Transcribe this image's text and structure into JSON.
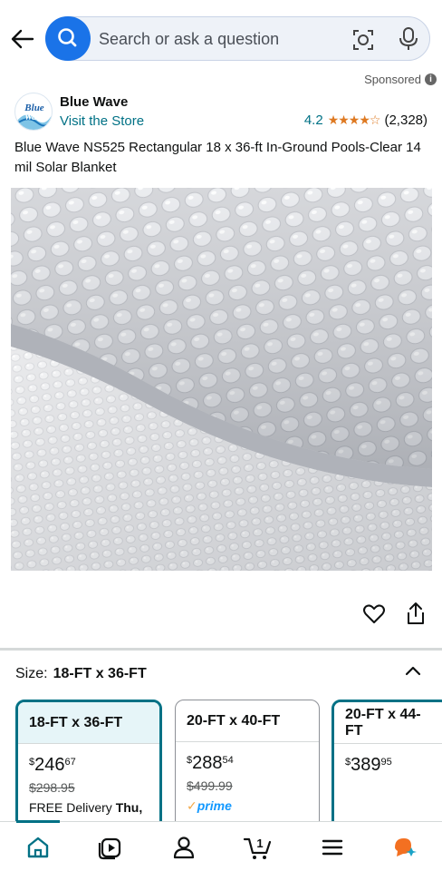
{
  "search": {
    "placeholder": "Search or ask a question"
  },
  "ad": {
    "sponsored_label": "Sponsored"
  },
  "brand": {
    "name": "Blue Wave",
    "logo_text": "Blue Wave",
    "visit_store": "Visit the Store",
    "rating": "4.2",
    "rating_value": 4.2,
    "rating_count": "(2,328)"
  },
  "product": {
    "title": "Blue Wave NS525 Rectangular 18 x 36-ft In-Ground Pools-Clear 14 mil Solar Blanket"
  },
  "size": {
    "label": "Size:",
    "selected": "18-FT x 36-FT",
    "options": [
      {
        "name": "18-FT x 36-FT",
        "price_whole": "246",
        "price_fraction": "67",
        "list_price": "$298.95",
        "delivery": "FREE Delivery ",
        "delivery_bold": "Thu,",
        "selected": true
      },
      {
        "name": "20-FT x 40-FT",
        "price_whole": "288",
        "price_fraction": "54",
        "list_price": "$499.99",
        "prime": "prime",
        "selected": false
      },
      {
        "name": "20-FT x 44-FT",
        "price_whole": "389",
        "price_fraction": "95",
        "selected": false
      }
    ],
    "currency": "$"
  },
  "nav": {
    "items": [
      "home-icon",
      "video-icon",
      "account-icon",
      "cart-icon",
      "menu-icon",
      "rufus-icon"
    ],
    "cart_count": "1"
  },
  "colors": {
    "accent": "#007185",
    "search_button": "#1a73e8",
    "star": "#de7921",
    "prime": "#1399ff"
  }
}
